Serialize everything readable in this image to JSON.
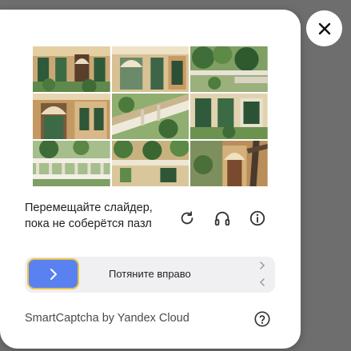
{
  "captcha": {
    "instruction_line1": "Перемещайте слайдер,",
    "instruction_line2": "пока не соберётся пазл",
    "slider_label": "Потяните вправо",
    "brand": "SmartCaptcha by Yandex Cloud",
    "icons": {
      "close": "close-icon",
      "refresh": "refresh-icon",
      "audio": "headphones-icon",
      "info": "info-icon",
      "slider": "chevron-right-icon",
      "help": "question-icon"
    },
    "colors": {
      "slider_handle": "#5a81f0",
      "slider_border": "#e8c44a",
      "track": "#f0f0f2"
    }
  }
}
